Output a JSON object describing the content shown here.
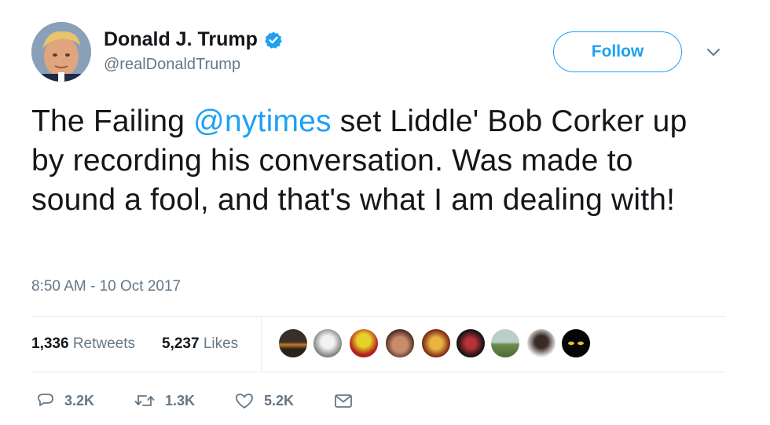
{
  "user": {
    "display_name": "Donald J. Trump",
    "handle": "@realDonaldTrump",
    "verified": true
  },
  "follow_label": "Follow",
  "tweet": {
    "text_before": "The Failing ",
    "mention": "@nytimes",
    "text_after": " set Liddle' Bob Corker up by recording his conversation. Was made to sound a fool, and that's what I am dealing with!"
  },
  "timestamp": "8:50 AM - 10 Oct 2017",
  "stats": {
    "retweets_count": "1,336",
    "retweets_label": "Retweets",
    "likes_count": "5,237",
    "likes_label": "Likes"
  },
  "actions": {
    "replies": "3.2K",
    "retweets": "1.3K",
    "likes": "5.2K"
  },
  "colors": {
    "accent": "#1da1f2",
    "text": "#14171a",
    "muted": "#657786",
    "divider": "#e6ecf0"
  }
}
